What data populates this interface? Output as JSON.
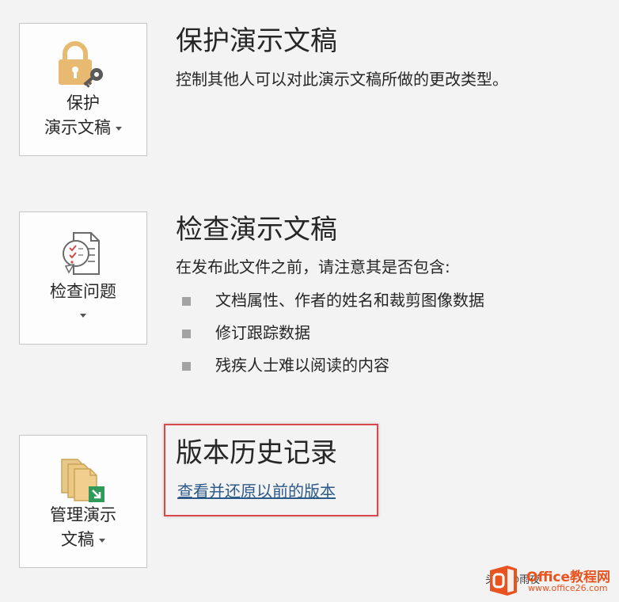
{
  "protect": {
    "tile_label_line1": "保护",
    "tile_label_line2": "演示文稿",
    "title": "保护演示文稿",
    "description": "控制其他人可以对此演示文稿所做的更改类型。",
    "icon": "lock-key-icon"
  },
  "inspect": {
    "tile_label": "检查问题",
    "title": "检查演示文稿",
    "description": "在发布此文件之前，请注意其是否包含:",
    "items": [
      "文档属性、作者的姓名和裁剪图像数据",
      "修订跟踪数据",
      "残疾人士难以阅读的内容"
    ],
    "icon": "document-checklist-icon"
  },
  "manage": {
    "tile_label_line1": "管理演示",
    "tile_label_line2": "文稿",
    "title": "版本历史记录",
    "link": "查看并还原以前的版本",
    "icon": "stacked-documents-icon"
  },
  "watermark": {
    "brand": "Office教程网",
    "url": "www.office26.com",
    "left_text": "头条 @雨夜"
  },
  "colors": {
    "background": "#f3f3f3",
    "tile_border": "#c6c6c6",
    "highlight_border": "#d9484d",
    "link": "#2e5a8a",
    "lock": "#e8b970",
    "watermark": "#e8531f"
  }
}
